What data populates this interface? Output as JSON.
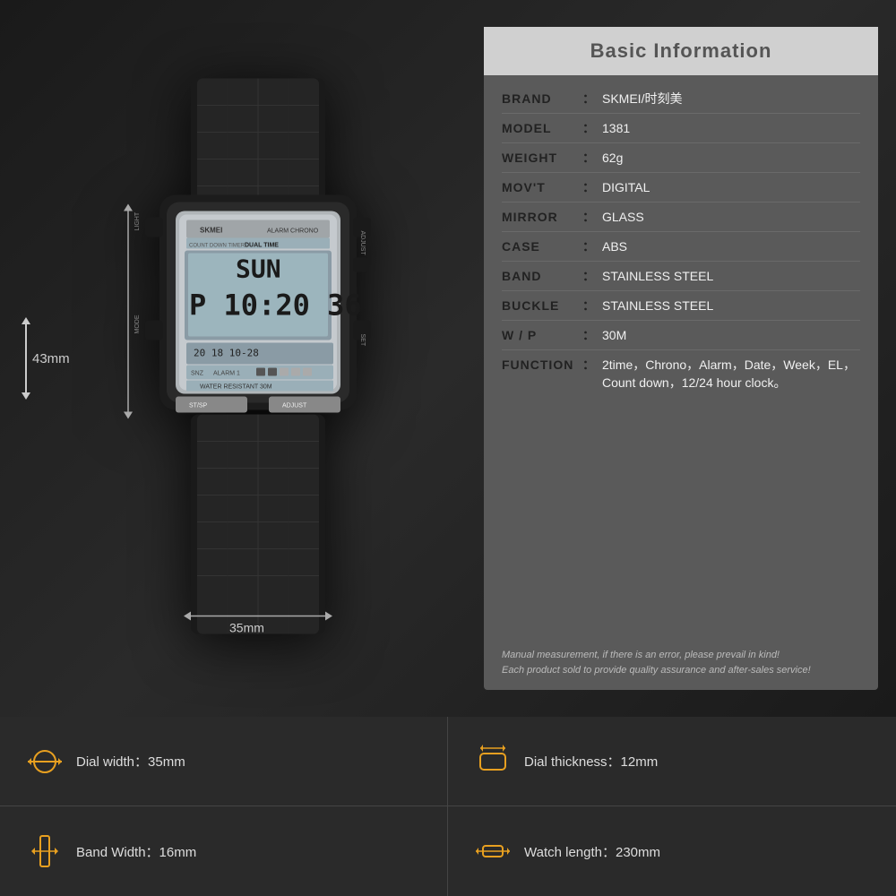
{
  "info": {
    "title": "Basic Information",
    "rows": [
      {
        "label": "BRAND",
        "value": "SKMEI/时刻美"
      },
      {
        "label": "MODEL",
        "value": "1381"
      },
      {
        "label": "WEIGHT",
        "value": "62g"
      },
      {
        "label": "MOV'T",
        "value": "DIGITAL"
      },
      {
        "label": "MIRROR",
        "value": "GLASS"
      },
      {
        "label": "CASE",
        "value": "ABS"
      },
      {
        "label": "BAND",
        "value": "STAINLESS STEEL"
      },
      {
        "label": "BUCKLE",
        "value": "STAINLESS STEEL"
      },
      {
        "label": "W / P",
        "value": "30M"
      },
      {
        "label": "FUNCTION",
        "value": "2time，Chrono，Alarm，Date，Week，EL，Count down，12/24 hour clock。"
      }
    ],
    "note1": "Manual measurement, if there is an error, please prevail in kind!",
    "note2": "Each product sold to provide quality assurance and after-sales service!"
  },
  "dimensions": {
    "height_label": "43mm",
    "width_label": "35mm"
  },
  "specs": [
    {
      "icon": "⌚",
      "label": "Dial width：35mm"
    },
    {
      "icon": "⊟",
      "label": "Dial thickness：12mm"
    },
    {
      "icon": "▣",
      "label": "Band Width：16mm"
    },
    {
      "icon": "↔",
      "label": "Watch length：230mm"
    }
  ]
}
